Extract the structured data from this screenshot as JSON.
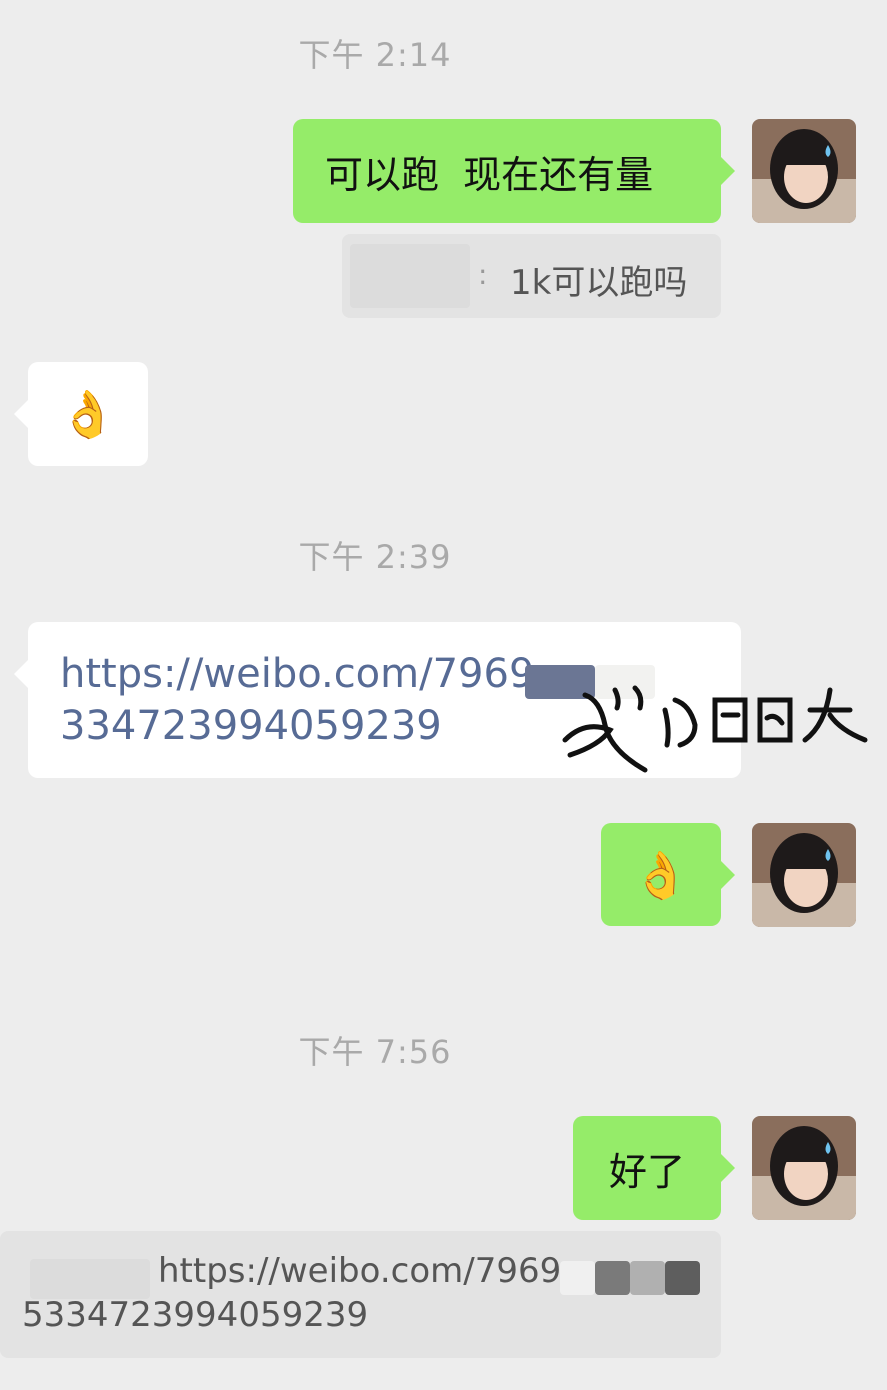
{
  "timestamps": [
    "下午 2:14",
    "下午 2:39",
    "下午 7:56"
  ],
  "messages": {
    "m1_text": "可以跑  现在还有量",
    "q1_sep": ":",
    "q1_text": "1k可以跑吗",
    "m2_emoji": "👌",
    "m3_link_line1": "https://weibo.com/7969",
    "m3_link_line2": "334723994059239",
    "m4_emoji": "👌",
    "m5_text": "好了",
    "q2_line1": "https://weibo.com/7969",
    "q2_line2": "5334723994059239"
  },
  "colors": {
    "background": "#ededed",
    "sent_bubble": "#95ec69",
    "received_bubble": "#ffffff",
    "link": "#576b95",
    "timestamp": "#a9a9a9"
  }
}
